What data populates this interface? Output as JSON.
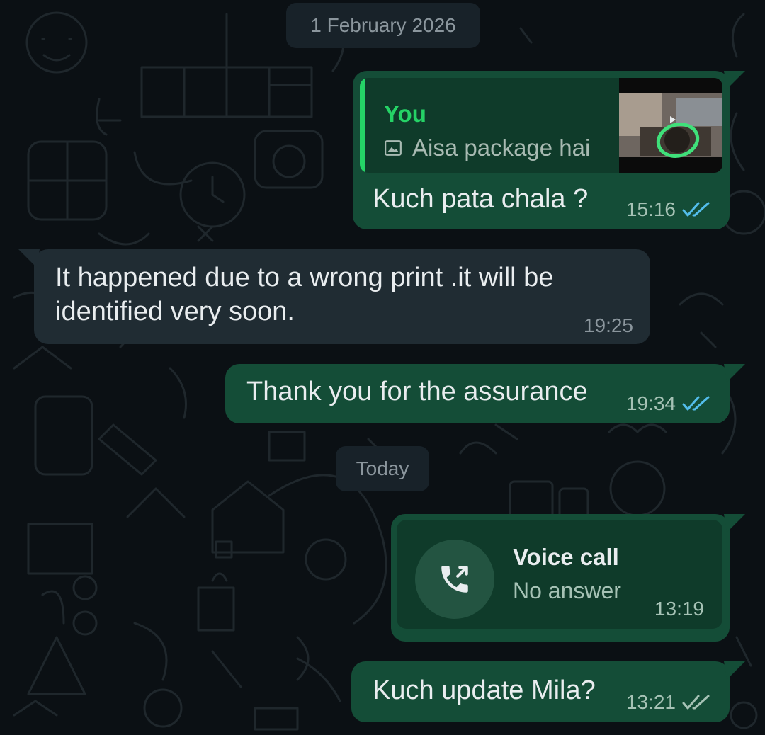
{
  "conversation": {
    "date_separators": [
      "1 February 2026",
      "Today"
    ],
    "messages": [
      {
        "direction": "outgoing",
        "reply_to": {
          "author": "You",
          "icon": "image-icon",
          "text": "Aisa package hai",
          "has_thumbnail": true
        },
        "text": "Kuch pata chala ?",
        "time": "15:16",
        "status": "read"
      },
      {
        "direction": "incoming",
        "text": "It happened due to a wrong print .it will be identified very soon.",
        "time": "19:25"
      },
      {
        "direction": "outgoing",
        "text": "Thank you for the assurance",
        "time": "19:34",
        "status": "read"
      },
      {
        "direction": "outgoing",
        "type": "call",
        "icon": "outgoing-call-icon",
        "call_title": "Voice call",
        "call_status": "No answer",
        "time": "13:19"
      },
      {
        "direction": "outgoing",
        "text": "Kuch update Mila?",
        "time": "13:21",
        "status": "delivered"
      }
    ]
  },
  "colors": {
    "background": "#0b1014",
    "outgoing_bubble": "#144d37",
    "incoming_bubble": "#202c33",
    "read_tick": "#53bdeb",
    "delivered_tick": "#a6c2b5",
    "quote_accent": "#25d366"
  }
}
